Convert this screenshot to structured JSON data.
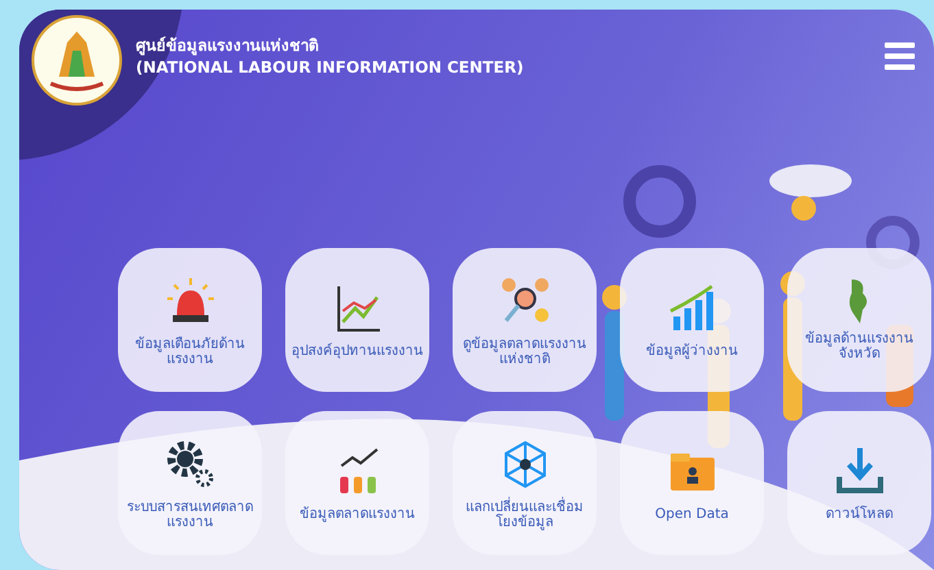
{
  "header": {
    "title_th": "ศูนย์ข้อมูลแรงงานแห่งชาติ",
    "title_en": "(NATIONAL LABOUR INFORMATION CENTER)"
  },
  "tiles": [
    {
      "label": "ข้อมูลเตือนภัยด้านแรงงาน"
    },
    {
      "label": "อุปสงค์อุปทานแรงงาน"
    },
    {
      "label": "ดูข้อมูลตลาดแรงงานแห่งชาติ"
    },
    {
      "label": "ข้อมูลผู้ว่างงาน"
    },
    {
      "label": "ข้อมูลด้านแรงงานจังหวัด"
    },
    {
      "label": "ระบบสารสนเทศตลาดแรงงาน"
    },
    {
      "label": "ข้อมูลตลาดแรงงาน"
    },
    {
      "label": "แลกเปลี่ยนและเชื่อมโยงข้อมูล"
    },
    {
      "label": "Open Data"
    },
    {
      "label": "ดาวน์โหลด"
    }
  ]
}
